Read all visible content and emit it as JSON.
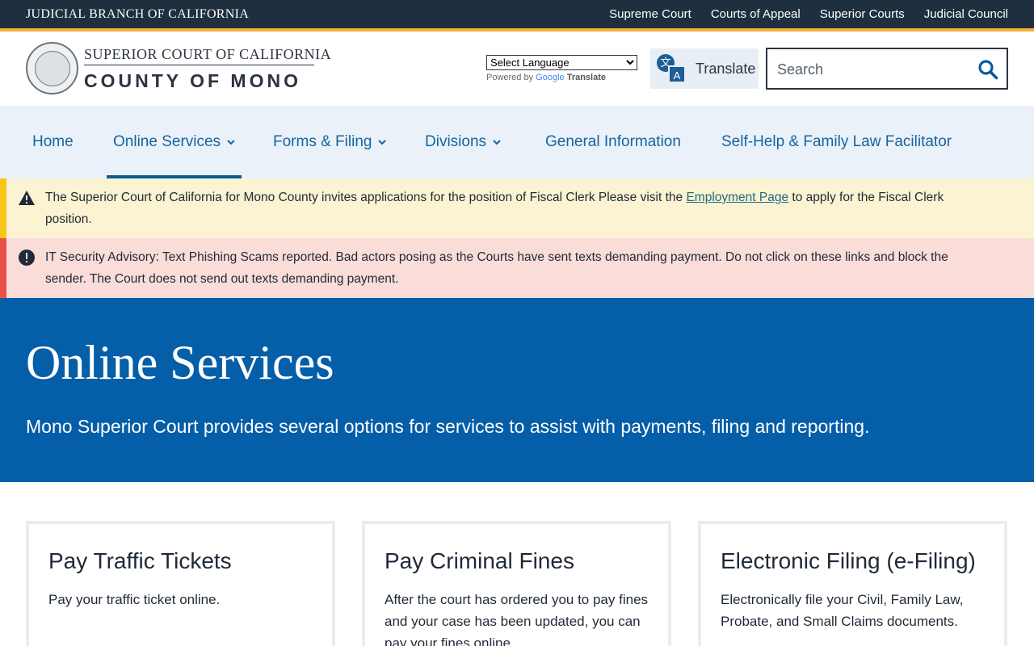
{
  "topbar": {
    "branch": "JUDICIAL BRANCH OF CALIFORNIA",
    "links": [
      "Supreme Court",
      "Courts of Appeal",
      "Superior Courts",
      "Judicial Council"
    ]
  },
  "header": {
    "line1": "SUPERIOR COURT OF CALIFORNIA",
    "line2": "COUNTY OF MONO",
    "language_select": "Select Language",
    "powered_prefix": "Powered by",
    "powered_google": "Google",
    "powered_translate": "Translate",
    "translate_label": "Translate",
    "search_placeholder": "Search"
  },
  "nav": {
    "items": [
      {
        "label": "Home"
      },
      {
        "label": "Online Services"
      },
      {
        "label": "Forms & Filing"
      },
      {
        "label": "Divisions"
      },
      {
        "label": "General Information"
      },
      {
        "label": "Self-Help & Family Law Facilitator"
      }
    ],
    "active": "Online Services"
  },
  "alerts": {
    "warning": {
      "text_before": "The Superior Court of California for Mono County invites applications for the position of Fiscal Clerk Please visit the ",
      "link": "Employment Page",
      "text_after": " to apply for the Fiscal Clerk position."
    },
    "error": {
      "text": "IT Security Advisory: Text Phishing Scams reported. Bad actors posing as the Courts have sent texts demanding payment. Do not click on these links and block the sender. The Court does not send out texts demanding payment."
    }
  },
  "hero": {
    "title": "Online Services",
    "subtitle": "Mono Superior Court provides several options for services to assist with payments, filing and reporting."
  },
  "cards": [
    {
      "title": "Pay Traffic Tickets",
      "text": "Pay your traffic ticket online."
    },
    {
      "title": "Pay Criminal Fines",
      "text": "After the court has ordered you to pay fines and your case has been updated, you can pay your fines online."
    },
    {
      "title": "Electronic Filing (e-Filing)",
      "text": "Electronically file your Civil, Family Law, Probate, and Small Claims documents."
    }
  ],
  "colors": {
    "topbar": "#1f2f40",
    "accent_gold": "#f2b134",
    "nav_bg": "#eaf1f8",
    "link_blue": "#1565a0",
    "hero_blue": "#045ea8",
    "warning_bg": "#fbf3d1",
    "error_bg": "#fadcd8"
  }
}
